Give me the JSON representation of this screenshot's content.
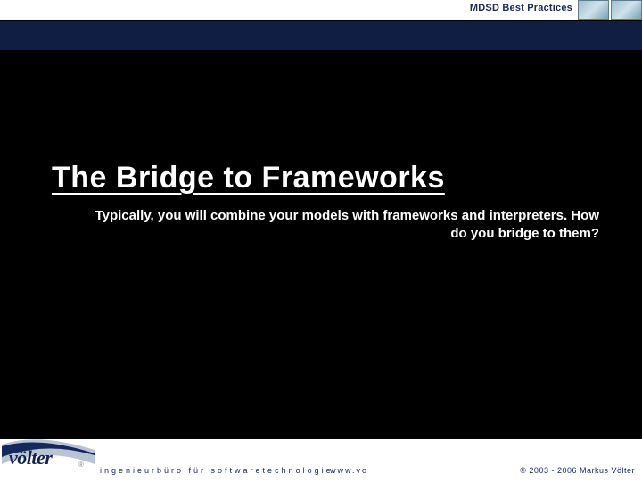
{
  "header": {
    "label": "MDSD Best Practices"
  },
  "title": "The Bridge to Frameworks",
  "subtitle": "Typically, you will combine your models with frameworks and interpreters. How do you bridge to them?",
  "footer": {
    "logo_text": "völter",
    "registered": "®",
    "tagline": "ingenieurbüro für softwaretechnologie",
    "link": "www.vo",
    "copyright": "© 2003 - 2006 Markus Völter"
  }
}
